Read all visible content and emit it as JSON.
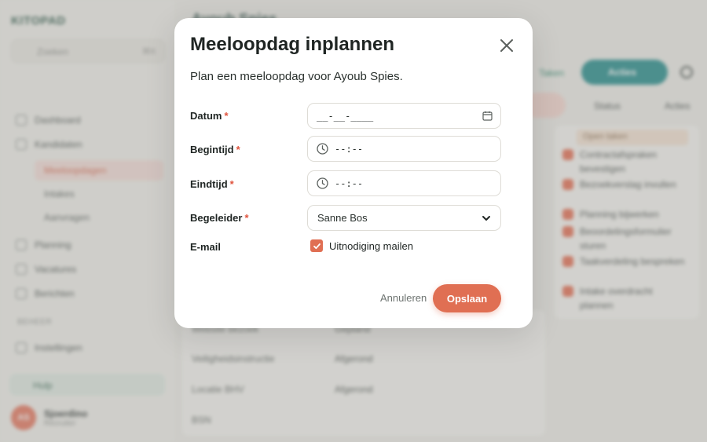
{
  "background": {
    "logo": "KITOPAD",
    "search_placeholder": "Zoeken",
    "search_shortcut": "⌘K",
    "sidebar_items": [
      {
        "label": "Dashboard",
        "icon": "home-icon"
      },
      {
        "label": "Kandidaten",
        "icon": "users-icon"
      },
      {
        "label": "Planning",
        "icon": "calendar-icon"
      },
      {
        "label": "Vacatures",
        "icon": "briefcase-icon"
      },
      {
        "label": "Berichten",
        "icon": "chat-icon"
      }
    ],
    "sidebar_subitems": [
      "Meeloopdagen",
      "Intakes",
      "Aanvragen"
    ],
    "section_label": "BEHEER",
    "section_item": "Instellingen",
    "help_label": "Hulp",
    "user": {
      "initials": "AS",
      "name": "Sjoerdino",
      "role": "Recruiter"
    },
    "page_title": "Ayoub Spies",
    "top_link": "Taken",
    "top_button": "Acties",
    "filters": [
      "Status",
      "Acties"
    ],
    "table_rows": [
      {
        "name": "Website bezoek",
        "status": "Gepland"
      },
      {
        "name": "Veiligheidsinstructie",
        "status": "Afgerond"
      },
      {
        "name": "Locatie BHV",
        "status": "Afgerond"
      },
      {
        "name": "BSN",
        "status": ""
      }
    ],
    "todo_header": "Open taken",
    "todo_items": [
      "Contractafspraken bevestigen",
      "Bezoekverslag invullen",
      "Planning bijwerken",
      "Beoordelingsformulier sturen",
      "Taakverdeling bespreken",
      "Intake overdracht plannen"
    ]
  },
  "modal": {
    "title": "Meeloopdag inplannen",
    "subtitle": "Plan een meeloopdag voor Ayoub Spies.",
    "required_mark": "*",
    "fields": {
      "date": {
        "label": "Datum",
        "value": "__-__-____",
        "icon": "calendar-icon"
      },
      "start_time": {
        "label": "Begintijd",
        "value": "--:--",
        "icon": "clock-icon"
      },
      "end_time": {
        "label": "Eindtijd",
        "value": "--:--",
        "icon": "clock-icon"
      },
      "supervisor": {
        "label": "Begeleider",
        "value": "Sanne Bos",
        "icon": "chevron-down-icon"
      },
      "email": {
        "label": "E-mail",
        "checkbox_label": "Uitnodiging mailen",
        "checked": true
      }
    },
    "buttons": {
      "cancel": "Annuleren",
      "save": "Opslaan"
    }
  },
  "colors": {
    "accent": "#e06f53",
    "required": "#e0533d",
    "teal": "#1f8b8a"
  }
}
